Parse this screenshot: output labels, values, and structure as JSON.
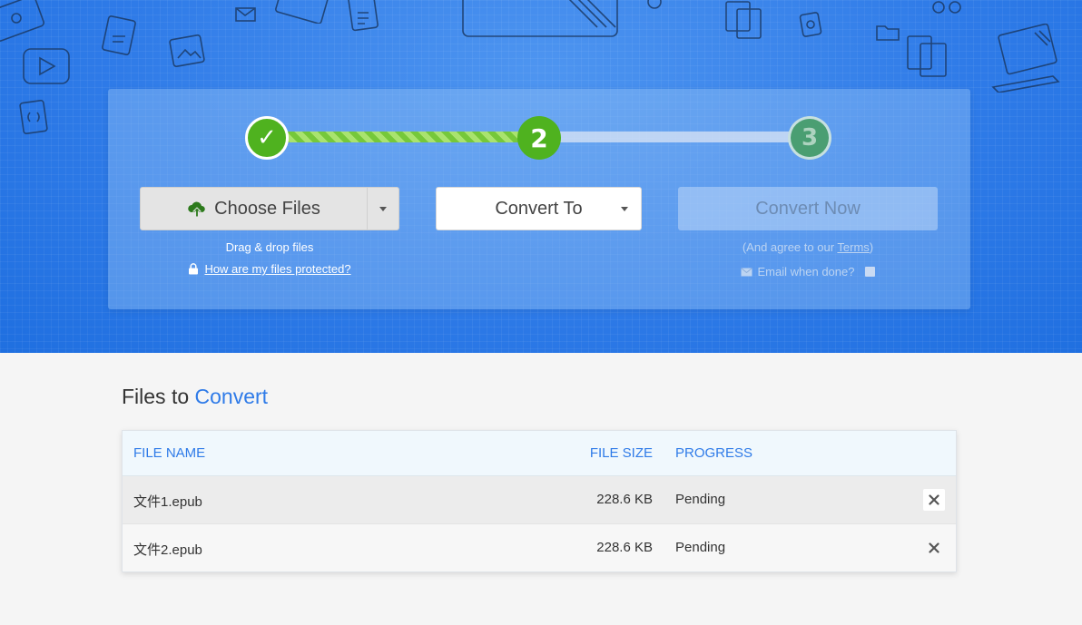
{
  "stepper": {
    "step1_symbol": "✓",
    "step2_number": "2",
    "step3_number": "3"
  },
  "upload": {
    "choose_files_label": "Choose Files",
    "drag_drop_text": "Drag & drop files",
    "protection_link": "How are my files protected?"
  },
  "convert_to": {
    "label": "Convert To"
  },
  "convert_now": {
    "label": "Convert Now",
    "agree_prefix": "(And agree to our ",
    "terms_link": "Terms",
    "agree_suffix": ")",
    "email_label": "Email when done?"
  },
  "files_section": {
    "title_prefix": "Files to ",
    "title_accent": "Convert",
    "columns": {
      "name": "FILE NAME",
      "size": "FILE SIZE",
      "progress": "PROGRESS"
    },
    "rows": [
      {
        "name": "文件1.epub",
        "size": "228.6 KB",
        "progress": "Pending"
      },
      {
        "name": "文件2.epub",
        "size": "228.6 KB",
        "progress": "Pending"
      }
    ]
  },
  "colors": {
    "hero_blue": "#2f7be8",
    "step_green": "#4fb21f",
    "accent_blue": "#2f7be8"
  },
  "icons": {
    "upload": "cloud-upload-icon",
    "lock": "lock-icon",
    "envelope": "envelope-icon",
    "remove": "close-icon"
  }
}
